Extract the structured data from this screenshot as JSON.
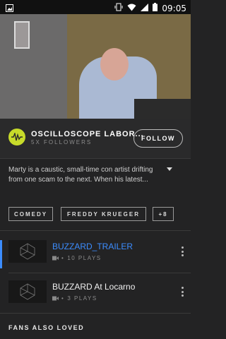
{
  "status_bar": {
    "time": "09:05"
  },
  "channel": {
    "name": "OSCILLOSCOPE LABOR...",
    "followers": "5X FOLLOWERS",
    "follow_label": "FOLLOW"
  },
  "description": "Marty is a caustic, small-time con artist drifting from one scam to the next. When his latest...",
  "tags": [
    "COMEDY",
    "FREDDY KRUEGER",
    "+8"
  ],
  "videos": [
    {
      "title": "BUZZARD_TRAILER",
      "plays": "10 PLAYS",
      "active": true
    },
    {
      "title": "BUZZARD At Locarno",
      "plays": "3 PLAYS",
      "active": false
    }
  ],
  "section_title": "FANS ALSO LOVED",
  "colors": {
    "accent": "#3c8dff",
    "background": "#232324"
  }
}
